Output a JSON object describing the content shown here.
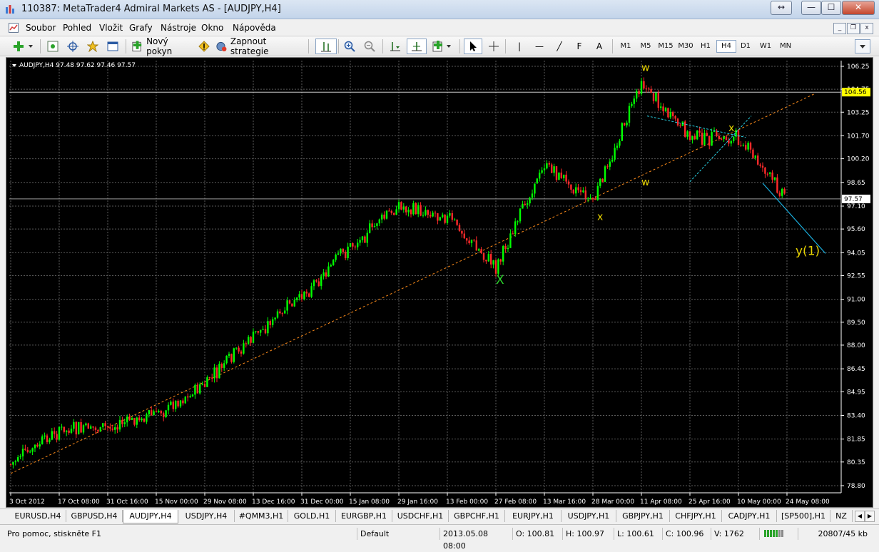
{
  "window": {
    "title": "110387: MetaTrader4 Admiral Markets AS - [AUDJPY,H4]",
    "restore_glyph": "↔",
    "min_glyph": "—",
    "max_glyph": "☐",
    "close_glyph": "✕"
  },
  "menu": {
    "items": [
      "Soubor",
      "Pohled",
      "Vložit",
      "Grafy",
      "Nástroje",
      "Okno",
      "Nápověda"
    ],
    "mdi_min": "_",
    "mdi_restore": "❐",
    "mdi_close": "x"
  },
  "toolbar": {
    "new_order_label": "Nový pokyn",
    "strategies_label": "Zapnout strategie",
    "timeframes": [
      "M1",
      "M5",
      "M15",
      "M30",
      "H1",
      "H4",
      "D1",
      "W1",
      "MN"
    ],
    "active_timeframe": "H4",
    "text_tool": "A",
    "line_tool": "|",
    "hline_tool": "—",
    "trend_tool": "╱",
    "fib_tool": "F"
  },
  "chart_data": {
    "type": "candlestick",
    "symbol_header": "AUDJPY,H4  97.48 97.62 97.46 97.57",
    "colors": {
      "background": "#000000",
      "grid": "#5a5a5a",
      "axis_text": "#ffffff",
      "bull": "#00ff00",
      "bear": "#ff2a2a",
      "trendline": "#ff8c1a",
      "triangle": "#2ad4e6",
      "projection": "#1ab0e0",
      "label_yellow": "#e6d200",
      "label_green": "#2ad42a",
      "price_box": "#ffff00"
    },
    "y_axis": {
      "ticks": [
        "106.25",
        "104.75",
        "103.25",
        "101.70",
        "100.20",
        "98.65",
        "97.10",
        "95.60",
        "94.05",
        "92.55",
        "91.00",
        "89.50",
        "88.00",
        "86.45",
        "84.95",
        "83.40",
        "81.85",
        "80.35",
        "78.80"
      ],
      "min": 78.8,
      "max": 106.25
    },
    "x_axis": {
      "ticks": [
        "3 Oct 2012",
        "17 Oct 08:00",
        "31 Oct 16:00",
        "15 Nov 00:00",
        "29 Nov 08:00",
        "13 Dec 16:00",
        "31 Dec 00:00",
        "15 Jan 08:00",
        "29 Jan 16:00",
        "13 Feb 00:00",
        "27 Feb 08:00",
        "13 Mar 16:00",
        "28 Mar 00:00",
        "11 Apr 08:00",
        "25 Apr 16:00",
        "10 May 00:00",
        "24 May 08:00"
      ]
    },
    "price_levels": {
      "horizontal_line": 104.56,
      "horizontal_line_label": "104.56",
      "bid": 97.57,
      "bid_label": "97.57"
    },
    "trendline": {
      "start": [
        "3 Oct 2012",
        79.6
      ],
      "end": [
        "24 May 08:00",
        103.6
      ]
    },
    "triangle": {
      "upper": [
        [
          "11 Apr 08:00",
          103.0
        ],
        [
          "10 May 00:00",
          101.6
        ]
      ],
      "lower": [
        [
          "25 Apr 16:00",
          98.7
        ],
        [
          "10 May 00:00",
          103.0
        ]
      ]
    },
    "projection": {
      "start": [
        "10 May 00:00",
        98.6
      ],
      "end": [
        "24 May 08:00",
        94.0
      ]
    },
    "anchors": [
      [
        "3 Oct 2012",
        80.2
      ],
      [
        "17 Oct 08:00",
        82.4
      ],
      [
        "31 Oct 16:00",
        82.6
      ],
      [
        "15 Nov 00:00",
        83.5
      ],
      [
        "29 Nov 08:00",
        85.4
      ],
      [
        "13 Dec 16:00",
        88.6
      ],
      [
        "31 Dec 00:00",
        91.2
      ],
      [
        "15 Jan 08:00",
        94.5
      ],
      [
        "29 Jan 16:00",
        97.1
      ],
      [
        "13 Feb 00:00",
        96.4
      ],
      [
        "27 Feb 08:00",
        93.1
      ],
      [
        "13 Mar 16:00",
        99.9
      ],
      [
        "28 Mar 00:00",
        97.3
      ],
      [
        "11 Apr 08:00",
        105.2
      ],
      [
        "25 Apr 16:00",
        101.6
      ],
      [
        "10 May 00:00",
        101.5
      ],
      [
        "24 May 08:00",
        97.57
      ]
    ],
    "wave_labels": [
      {
        "text": "w",
        "at": [
          "11 Apr 08:00",
          105.95
        ],
        "color": "yellow"
      },
      {
        "text": "w",
        "at": [
          "11 Apr 08:00",
          98.45
        ],
        "color": "yellow"
      },
      {
        "text": "x",
        "at": [
          "28 Mar 00:00",
          96.2
        ],
        "color": "yellow"
      },
      {
        "text": "x",
        "at": [
          "10 May 00:00",
          102.0
        ],
        "color": "yellow"
      },
      {
        "text": "X",
        "at": [
          "27 Feb 08:00",
          92.0
        ],
        "color": "green"
      },
      {
        "text": "y(1)",
        "at": [
          "24 May 08:00",
          93.9
        ],
        "color": "yellow"
      }
    ]
  },
  "tabs": {
    "items": [
      "EURUSD,H4",
      "GBPUSD,H4",
      "AUDJPY,H4",
      "USDJPY,H4",
      "#QMM3,H1",
      "GOLD,H1",
      "EURGBP,H1",
      "USDCHF,H1",
      "GBPCHF,H1",
      "EURJPY,H1",
      "USDJPY,H1",
      "GBPJPY,H1",
      "CHFJPY,H1",
      "CADJPY,H1",
      "[SP500],H1",
      "NZ"
    ],
    "active": "AUDJPY,H4",
    "left_arrow": "◀",
    "right_arrow": "▶"
  },
  "status": {
    "help": "Pro pomoc, stiskněte F1",
    "profile": "Default",
    "datetime": "2013.05.08 08:00",
    "open": "O: 100.81",
    "high": "H: 100.97",
    "low": "L: 100.61",
    "close": "C: 100.96",
    "volume": "V: 1762",
    "traffic": "20807/45 kb"
  }
}
